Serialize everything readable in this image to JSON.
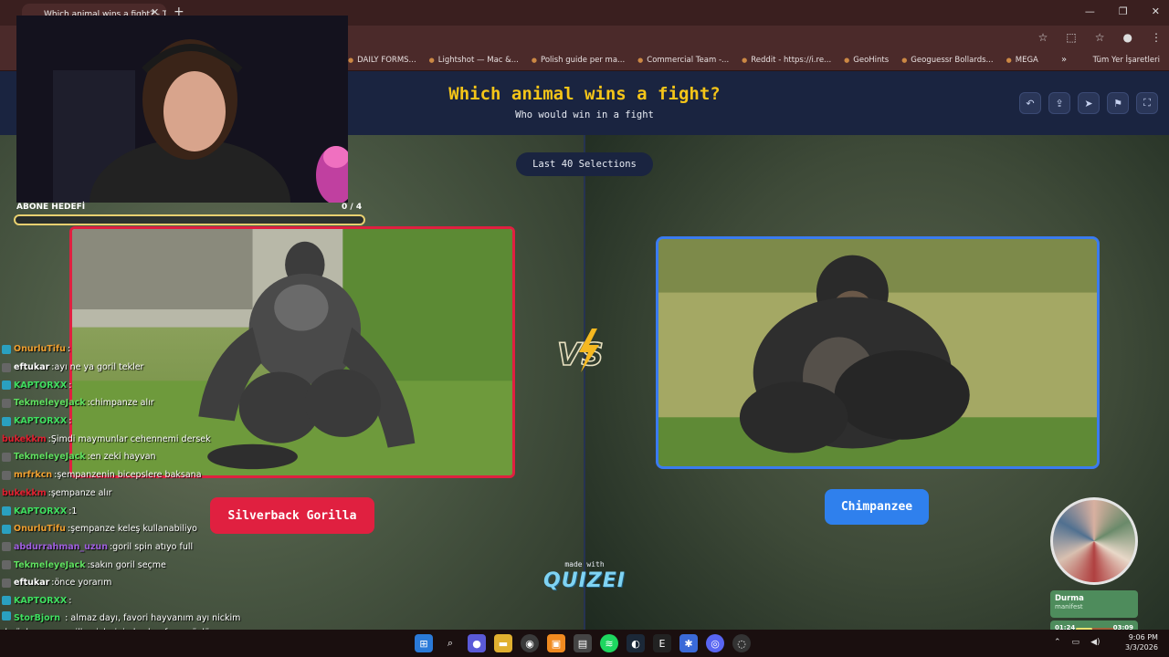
{
  "browser": {
    "tab_title": "Which animal wins a fight? - Ti",
    "bookmarks": [
      "DAILY FORMS...",
      "Lightshot — Mac &...",
      "Polish guide per ma...",
      "Commercial Team -...",
      "Reddit - https://i.re...",
      "GeoHints",
      "Geoguessr Bollards...",
      "MEGA"
    ],
    "all_bookmarks_label": "Tüm Yer İşaretleri"
  },
  "page": {
    "title": "Which animal wins a fight?",
    "subtitle": "Who would win in a fight",
    "last_selections": "Last 40 Selections",
    "left_option": "Silverback Gorilla",
    "right_option": "Chimpanzee",
    "made_with": "made with",
    "brand": "QUIZEI"
  },
  "overlay": {
    "goal_label": "ABONE HEDEFİ",
    "goal_count": "0  / 4",
    "goal_progress": 0,
    "chat": [
      {
        "user": "OnurluTifu",
        "sep": " : ",
        "msg": "",
        "color": "#f0a030",
        "badge": "#2aa0c0"
      },
      {
        "user": "eftukar",
        "sep": " : ",
        "msg": "ayı ne ya goril tekler",
        "color": "#ffffff",
        "badge": "#666666"
      },
      {
        "user": "KAPTORXX",
        "sep": " : ",
        "msg": "",
        "color": "#40e060",
        "badge": "#2aa0c0"
      },
      {
        "user": "TekmeleyeJack",
        "sep": " : ",
        "msg": "chimpanze alır",
        "color": "#60e060",
        "badge": "#666666"
      },
      {
        "user": "KAPTORXX",
        "sep": " : ",
        "msg": "",
        "color": "#40e060",
        "badge": "#2aa0c0"
      },
      {
        "user": "bukekkm",
        "sep": " : ",
        "msg": "Şimdi maymunlar cehennemi dersek",
        "color": "#e02030",
        "badge": ""
      },
      {
        "user": "TekmeleyeJack",
        "sep": " : ",
        "msg": "en zeki hayvan",
        "color": "#60e060",
        "badge": "#666666"
      },
      {
        "user": "mrfrkcn",
        "sep": " : ",
        "msg": "şempanzenin bicepslere baksana",
        "color": "#f0a030",
        "badge": "#666666"
      },
      {
        "user": "bukekkm",
        "sep": " : ",
        "msg": "şempanze alır",
        "color": "#e02030",
        "badge": ""
      },
      {
        "user": "KAPTORXX",
        "sep": " : ",
        "msg": "1",
        "color": "#40e060",
        "badge": "#2aa0c0"
      },
      {
        "user": "OnurluTifu",
        "sep": " : ",
        "msg": "şempanze keleş kullanabiliyo",
        "color": "#f0a030",
        "badge": "#2aa0c0"
      },
      {
        "user": "abdurrahman_uzun",
        "sep": " : ",
        "msg": "goril spin atıyo full",
        "color": "#a060e0",
        "badge": "#666666"
      },
      {
        "user": "TekmeleyeJack",
        "sep": " : ",
        "msg": "sakın goril seçme",
        "color": "#60e060",
        "badge": "#666666"
      },
      {
        "user": "eftukar",
        "sep": " : ",
        "msg": "önce yorarım",
        "color": "#ffffff",
        "badge": "#666666"
      },
      {
        "user": "KAPTORXX",
        "sep": " : ",
        "msg": "",
        "color": "#40e060",
        "badge": "#2aa0c0"
      }
    ],
    "last_chat_user": "StorBjorn",
    "last_chat_msg": " : almaz dayı, favori hayvanım ayı nickim de öyle. ama gorilla piçlerinin kasları fena güçlü. yumrukla bayıltır ayıyı",
    "music_title": "Durma",
    "music_artist": "manifest",
    "music_elapsed": "01:24",
    "music_total": "03:09",
    "music_progress": 0.44
  },
  "taskbar": {
    "time": "9:06 PM",
    "date": "3/3/2026"
  },
  "colors": {
    "title_yellow": "#f5c518",
    "left_red": "#e02040",
    "right_blue": "#2f80ed",
    "header_navy": "#1a2440"
  }
}
